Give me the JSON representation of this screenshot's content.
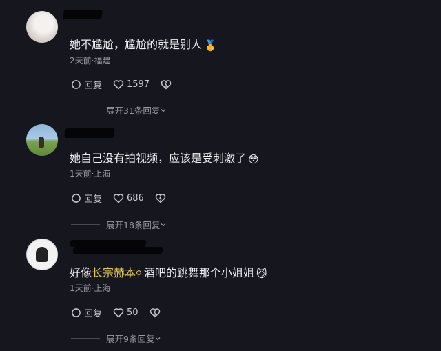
{
  "comments": [
    {
      "text": "她不尴尬，尴尬的就是别人",
      "emoji": "🥇",
      "meta": "2天前·福建",
      "reply_label": "回复",
      "likes": "1597",
      "expand_label": "展开31条回复"
    },
    {
      "text": "她自己没有拍视频，应该是受刺激了",
      "emoji": "😳",
      "meta": "1天前·上海",
      "reply_label": "回复",
      "likes": "686",
      "expand_label": "展开18条回复"
    },
    {
      "text_prefix": "好像",
      "search_link": "长宗赫本",
      "text_suffix": "酒吧的跳舞那个小姐姐",
      "emoji": "😼",
      "meta": "1天前·上海",
      "reply_label": "回复",
      "likes": "50",
      "expand_label": "展开9条回复"
    }
  ],
  "icons": {
    "reply": "comment-bubble-icon",
    "like": "heart-icon",
    "dislike": "broken-heart-icon",
    "expand": "chevron-down-icon",
    "search": "search-icon"
  },
  "colors": {
    "background": "#16161e",
    "search_link": "#e0c55a",
    "meta": "#9a9aa3"
  }
}
